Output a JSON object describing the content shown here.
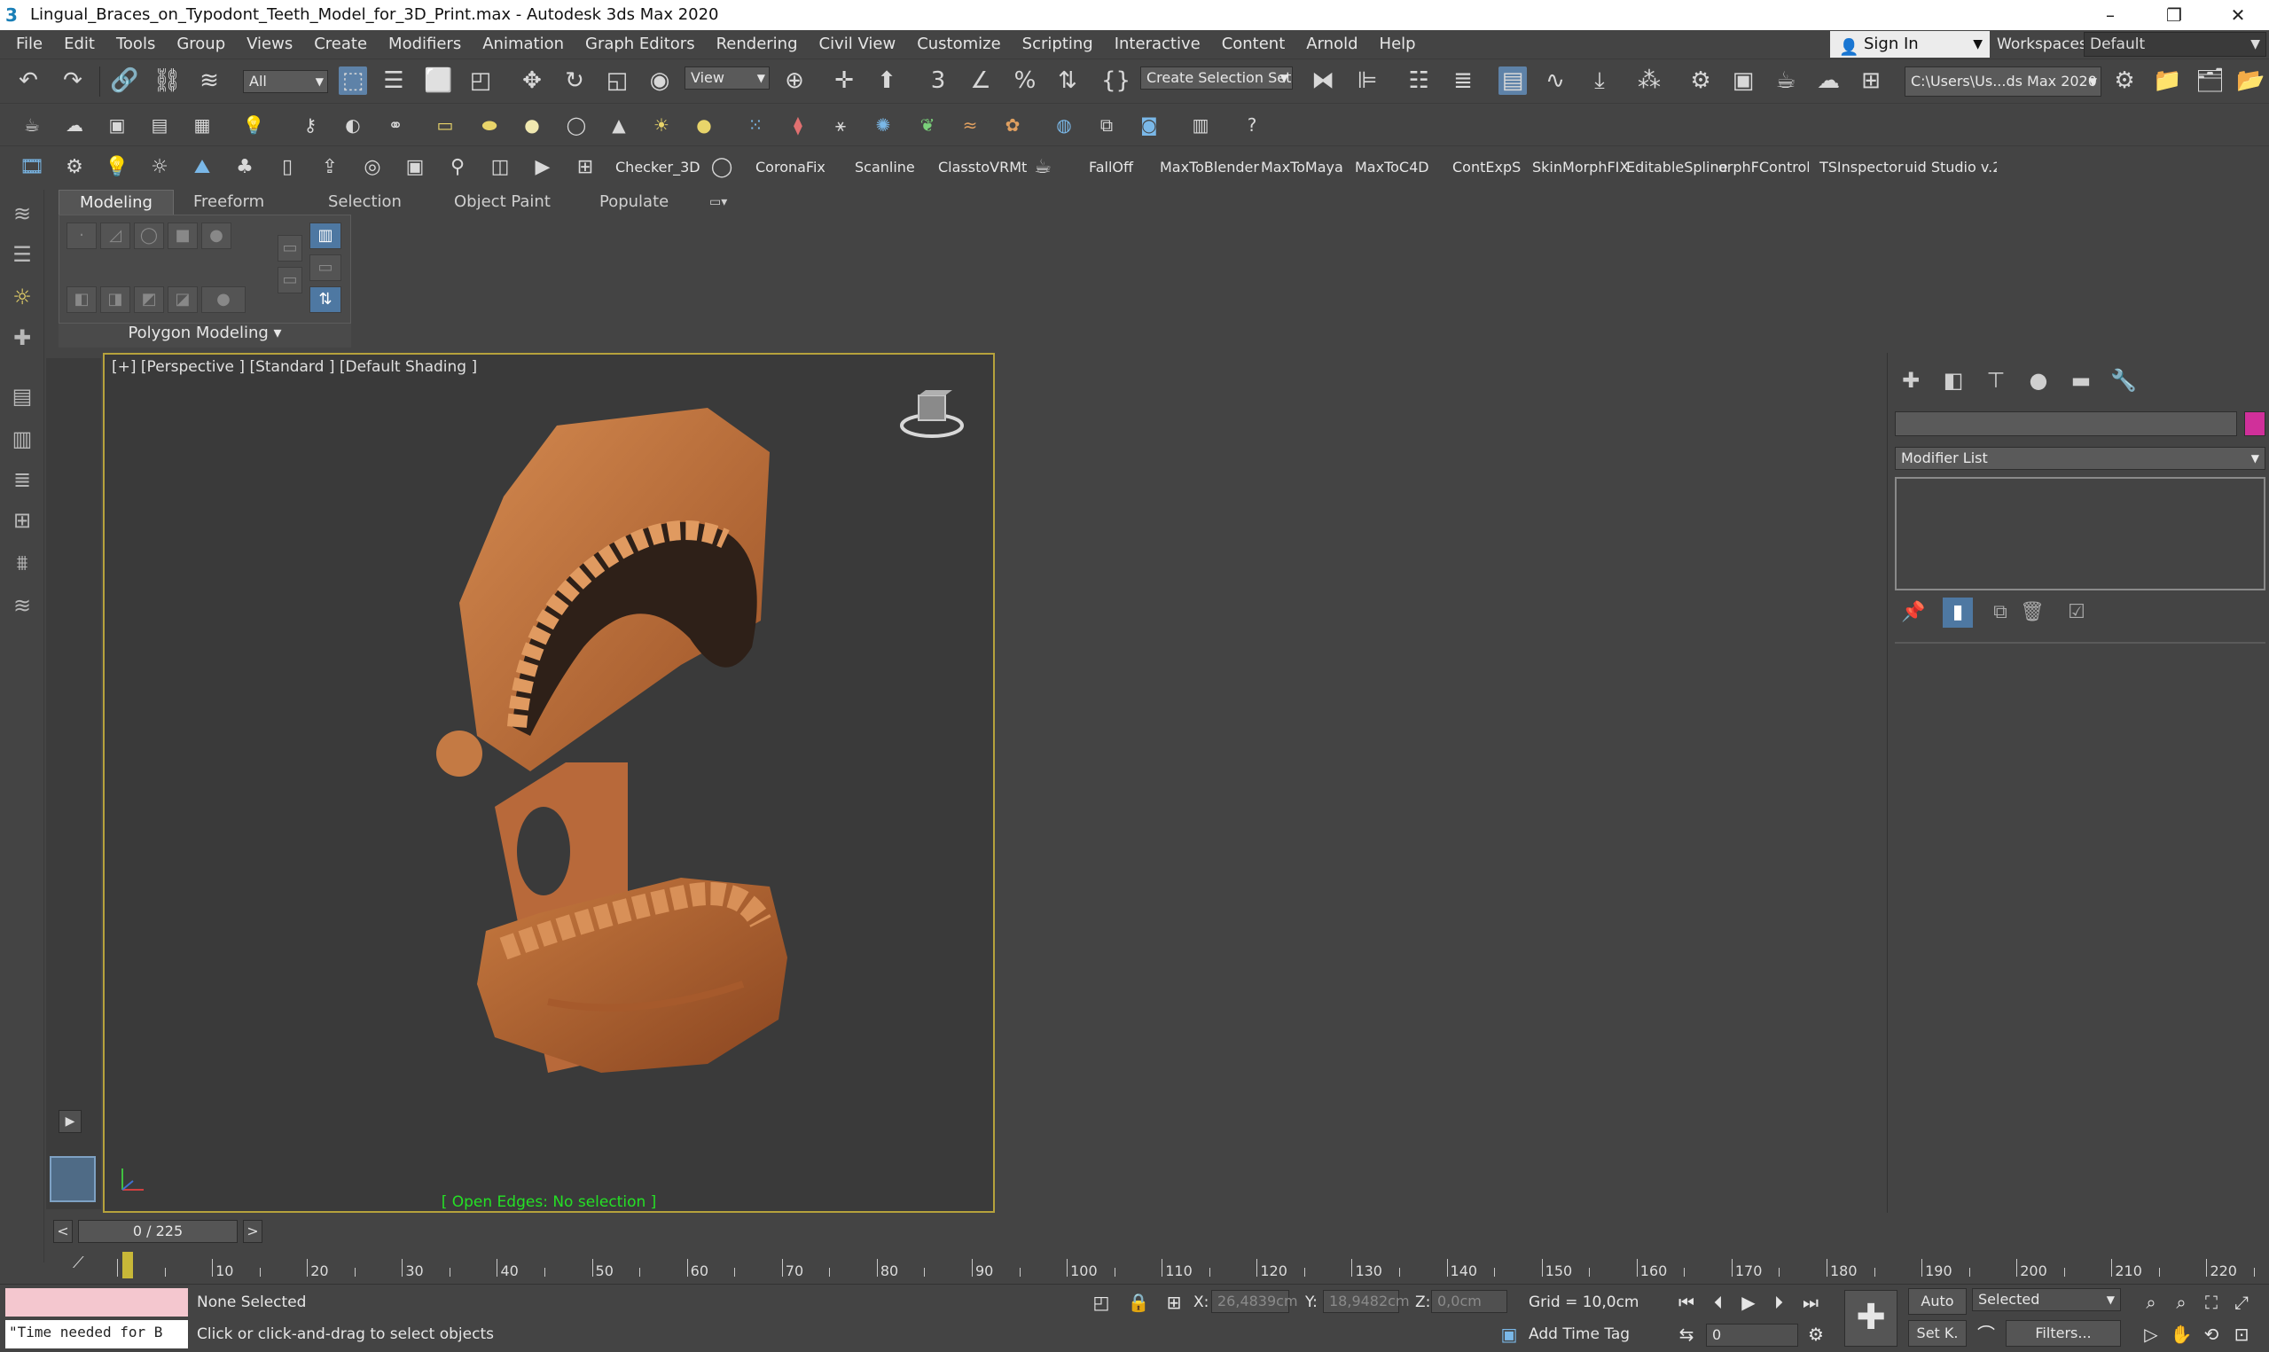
{
  "title": "Lingual_Braces_on_Typodont_Teeth_Model_for_3D_Print.max - Autodesk 3ds Max 2020",
  "window": {
    "minimize": "–",
    "restore": "❐",
    "close": "✕"
  },
  "menu": [
    "File",
    "Edit",
    "Tools",
    "Group",
    "Views",
    "Create",
    "Modifiers",
    "Animation",
    "Graph Editors",
    "Rendering",
    "Civil View",
    "Customize",
    "Scripting",
    "Interactive",
    "Content",
    "Arnold",
    "Help"
  ],
  "account": {
    "sign_in": "Sign In",
    "workspaces_label": "Workspaces:",
    "workspace": "Default"
  },
  "main_toolbar": {
    "selection_filter": "All",
    "ref_coord": "View",
    "named_sel": "Create Selection Set",
    "project_path": "C:\\Users\\Us...ds Max 2020"
  },
  "plugin_toolbar": [
    "Checker_3D",
    "CoronaFix",
    "Scanline",
    "ClasstoVRMt",
    "FallOff",
    "MaxToBlender",
    "MaxToMaya",
    "MaxToC4D",
    "ContExpS",
    "SkinMorphFIX",
    "EditableSpline",
    "orphFControll",
    "TSInspector",
    "uid Studio v.2."
  ],
  "ribbon": {
    "tabs": [
      "Modeling",
      "Freeform",
      "Selection",
      "Object Paint",
      "Populate"
    ],
    "panel_label": "Polygon Modeling"
  },
  "viewport": {
    "label": "[+] [Perspective ] [Standard ] [Default Shading ]",
    "status": "[ Open Edges: No selection ]",
    "model_color": "#c4703c"
  },
  "command_panel": {
    "modifier_list": "Modifier List",
    "object_color": "#d0309a"
  },
  "timeline": {
    "frame_display": "0 / 225",
    "prev": "<",
    "next": ">",
    "labels": [
      "10",
      "20",
      "30",
      "40",
      "50",
      "60",
      "70",
      "80",
      "90",
      "100",
      "110",
      "120",
      "130",
      "140",
      "150",
      "160",
      "170",
      "180",
      "190",
      "200",
      "210",
      "220"
    ]
  },
  "status": {
    "maxscript_output": "\"Time needed for B",
    "selection": "None Selected",
    "prompt": "Click or click-and-drag to select objects",
    "x_label": "X:",
    "x_value": "26,4839cm",
    "y_label": "Y:",
    "y_value": "18,9482cm",
    "z_label": "Z:",
    "z_value": "0,0cm",
    "grid": "Grid = 10,0cm",
    "add_time_tag": "Add Time Tag",
    "auto": "Auto",
    "set_key": "Set K.",
    "key_filter": "Selected",
    "filters": "Filters...",
    "current_frame": "0"
  }
}
